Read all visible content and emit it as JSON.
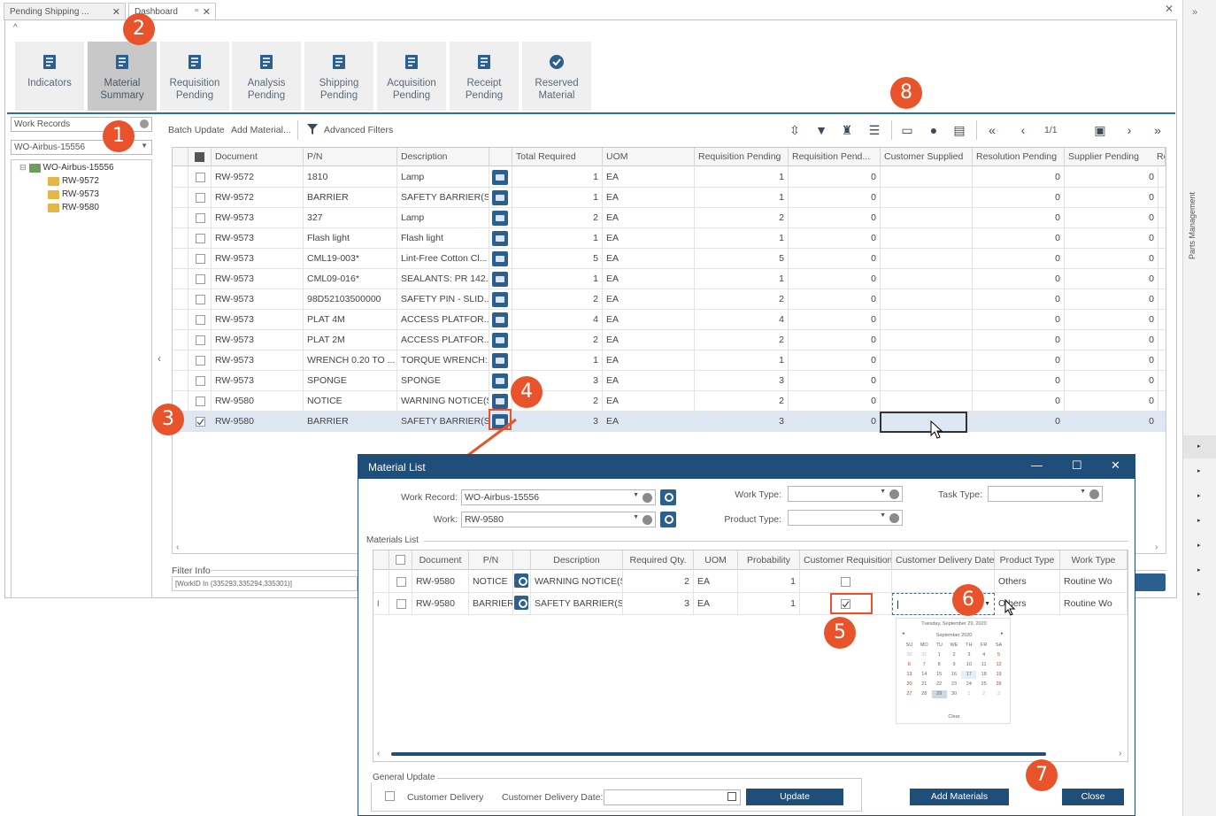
{
  "tabs": [
    {
      "label": "Pending Shipping ..."
    },
    {
      "label": "Dashboard"
    }
  ],
  "ribbon": [
    {
      "label": "Indicators"
    },
    {
      "label": "Material\nSummary"
    },
    {
      "label": "Requisition\nPending"
    },
    {
      "label": "Analysis\nPending"
    },
    {
      "label": "Shipping\nPending"
    },
    {
      "label": "Acquisition\nPending"
    },
    {
      "label": "Receipt\nPending"
    },
    {
      "label": "Reserved\nMaterial"
    }
  ],
  "left": {
    "filter_combo": "Work Records",
    "wo_combo": "WO-Airbus-15556",
    "tree_root": "WO-Airbus-15556",
    "tree_children": [
      "RW-9572",
      "RW-9573",
      "RW-9580"
    ],
    "filter_info_label": "Filter Info",
    "filter_info_value": "[WorkID In (335293,335294,335301)]"
  },
  "toolbar": {
    "batch_update": "Batch Update",
    "add_material": "Add Material...",
    "advanced_filters": "Advanced Filters",
    "page": "1/1"
  },
  "grid": {
    "headers": [
      "Document",
      "P/N",
      "Description",
      "Total Required",
      "UOM",
      "Requisition Pending",
      "Requisition Pend...",
      "Customer Supplied",
      "Resolution Pending",
      "Supplier Pending",
      "Re"
    ],
    "rows": [
      {
        "doc": "RW-9572",
        "pn": "1810",
        "desc": "Lamp",
        "total": "1",
        "uom": "EA",
        "req": "1",
        "req2": "0",
        "cs": "",
        "res": "0",
        "sup": "0"
      },
      {
        "doc": "RW-9572",
        "pn": "BARRIER",
        "desc": "SAFETY BARRIER(S)",
        "total": "1",
        "uom": "EA",
        "req": "1",
        "req2": "0",
        "cs": "",
        "res": "0",
        "sup": "0"
      },
      {
        "doc": "RW-9573",
        "pn": "327",
        "desc": "Lamp",
        "total": "2",
        "uom": "EA",
        "req": "2",
        "req2": "0",
        "cs": "",
        "res": "0",
        "sup": "0"
      },
      {
        "doc": "RW-9573",
        "pn": "Flash light",
        "desc": "Flash light",
        "total": "1",
        "uom": "EA",
        "req": "1",
        "req2": "0",
        "cs": "",
        "res": "0",
        "sup": "0"
      },
      {
        "doc": "RW-9573",
        "pn": "CML19-003*",
        "desc": "Lint-Free Cotton Cl...",
        "total": "5",
        "uom": "EA",
        "req": "5",
        "req2": "0",
        "cs": "",
        "res": "0",
        "sup": "0"
      },
      {
        "doc": "RW-9573",
        "pn": "CML09-016*",
        "desc": "SEALANTS: PR 142...",
        "total": "1",
        "uom": "EA",
        "req": "1",
        "req2": "0",
        "cs": "",
        "res": "0",
        "sup": "0"
      },
      {
        "doc": "RW-9573",
        "pn": "98D52103500000",
        "desc": "SAFETY PIN - SLID...",
        "total": "2",
        "uom": "EA",
        "req": "2",
        "req2": "0",
        "cs": "",
        "res": "0",
        "sup": "0"
      },
      {
        "doc": "RW-9573",
        "pn": "PLAT 4M",
        "desc": "ACCESS PLATFOR...",
        "total": "4",
        "uom": "EA",
        "req": "4",
        "req2": "0",
        "cs": "",
        "res": "0",
        "sup": "0"
      },
      {
        "doc": "RW-9573",
        "pn": "PLAT 2M",
        "desc": "ACCESS PLATFOR...",
        "total": "2",
        "uom": "EA",
        "req": "2",
        "req2": "0",
        "cs": "",
        "res": "0",
        "sup": "0"
      },
      {
        "doc": "RW-9573",
        "pn": "WRENCH 0.20 TO ...",
        "desc": "TORQUE WRENCH:...",
        "total": "1",
        "uom": "EA",
        "req": "1",
        "req2": "0",
        "cs": "",
        "res": "0",
        "sup": "0"
      },
      {
        "doc": "RW-9573",
        "pn": "SPONGE",
        "desc": "SPONGE",
        "total": "3",
        "uom": "EA",
        "req": "3",
        "req2": "0",
        "cs": "",
        "res": "0",
        "sup": "0"
      },
      {
        "doc": "RW-9580",
        "pn": "NOTICE",
        "desc": "WARNING NOTICE(S)",
        "total": "2",
        "uom": "EA",
        "req": "2",
        "req2": "0",
        "cs": "",
        "res": "0",
        "sup": "0"
      },
      {
        "doc": "RW-9580",
        "pn": "BARRIER",
        "desc": "SAFETY BARRIER(S)",
        "total": "3",
        "uom": "EA",
        "req": "3",
        "req2": "0",
        "cs": "",
        "res": "0",
        "sup": "0"
      }
    ]
  },
  "modal": {
    "title": "Material List",
    "work_record_label": "Work Record:",
    "work_record_value": "WO-Airbus-15556",
    "work_label": "Work:",
    "work_value": "RW-9580",
    "work_type_label": "Work Type:",
    "product_type_label": "Product Type:",
    "task_type_label": "Task Type:",
    "materials_list_label": "Materials List",
    "headers": [
      "Document",
      "P/N",
      "Description",
      "Required Qty.",
      "UOM",
      "Probability",
      "Customer Requisition",
      "Customer Delivery Date",
      "Product Type",
      "Work Type"
    ],
    "rows": [
      {
        "doc": "RW-9580",
        "pn": "NOTICE",
        "desc": "WARNING NOTICE(S)",
        "qty": "2",
        "uom": "EA",
        "prob": "1",
        "ptype": "Others",
        "wtype": "Routine Wo"
      },
      {
        "doc": "RW-9580",
        "pn": "BARRIER",
        "desc": "SAFETY BARRIER(S)",
        "qty": "3",
        "uom": "EA",
        "prob": "1",
        "ptype": "Others",
        "wtype": "Routine Wo"
      }
    ],
    "general_update_label": "General Update",
    "customer_delivery_label": "Customer Delivery",
    "customer_delivery_date_label": "Customer Delivery Date:",
    "update_button": "Update",
    "add_materials_button": "Add Materials",
    "close_button": "Close"
  },
  "calendar": {
    "today": "Tuesday, September 29, 2020",
    "month": "September 2020",
    "weekdays": [
      "SU",
      "MO",
      "TU",
      "WE",
      "TH",
      "FR",
      "SA"
    ],
    "days": [
      "30",
      "31",
      "1",
      "2",
      "3",
      "4",
      "5",
      "6",
      "7",
      "8",
      "9",
      "10",
      "11",
      "12",
      "13",
      "14",
      "15",
      "16",
      "17",
      "18",
      "19",
      "20",
      "21",
      "22",
      "23",
      "24",
      "25",
      "26",
      "27",
      "28",
      "29",
      "30",
      "1",
      "2",
      "3"
    ],
    "clear": "Clear"
  },
  "callouts": [
    "1",
    "2",
    "3",
    "4",
    "5",
    "6",
    "7",
    "8"
  ],
  "side_panel_label": "Parts Management"
}
